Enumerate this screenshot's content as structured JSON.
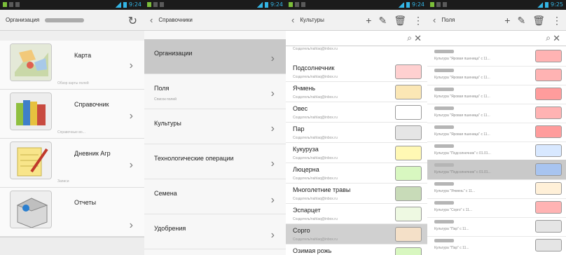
{
  "status_time": "9:24",
  "status_time2": "9:25",
  "panel1": {
    "title": "Организация",
    "items": [
      {
        "label": "Карта",
        "sub": "Обзор карты полей",
        "icon": "map-icon"
      },
      {
        "label": "Справочник",
        "sub": "Справочные во...",
        "icon": "books-icon"
      },
      {
        "label": "Дневник Агр",
        "sub": "Записи",
        "icon": "notepad-icon"
      },
      {
        "label": "Отчеты",
        "sub": "",
        "icon": "box-icon"
      }
    ]
  },
  "panel2": {
    "title": "Справочники",
    "items": [
      {
        "label": "Организации",
        "sub": ""
      },
      {
        "label": "Поля",
        "sub": "Список полей"
      },
      {
        "label": "Культуры",
        "sub": ""
      },
      {
        "label": "Технологические операции",
        "sub": ""
      },
      {
        "label": "Семена",
        "sub": ""
      },
      {
        "label": "Удобрения",
        "sub": ""
      }
    ]
  },
  "panel3": {
    "title": "Культуры",
    "first_mail": "Создатель/nahlaq@inbox.ru",
    "rows": [
      {
        "name": "Подсолнечник",
        "mail": "Создатель/nahlaq@inbox.ru",
        "color": "#ffd0d0"
      },
      {
        "name": "Ячмень",
        "mail": "Создатель/nahlaq@inbox.ru",
        "color": "#fbe7b5"
      },
      {
        "name": "Овес",
        "mail": "Создатель/nahlaq@inbox.ru",
        "color": "#ffffff"
      },
      {
        "name": "Пар",
        "mail": "Создатель/nahlaq@inbox.ru",
        "color": "#e5e5e5"
      },
      {
        "name": "Кукуруза",
        "mail": "Создатель/nahlaq@inbox.ru",
        "color": "#fff8b4"
      },
      {
        "name": "Люцерна",
        "mail": "Создатель/nahlaq@inbox.ru",
        "color": "#d8f7c0"
      },
      {
        "name": "Многолетние травы",
        "mail": "Создатель/nahlaq@inbox.ru",
        "color": "#c8dbb8"
      },
      {
        "name": "Эспарцет",
        "mail": "Создатель/nahlaq@inbox.ru",
        "color": "#eef9e2"
      },
      {
        "name": "Сорго",
        "mail": "Создатель/nahlaq@inbox.ru",
        "color": "#f4e0c8"
      },
      {
        "name": "Озимая рожь",
        "mail": "",
        "color": "#d8f7c0"
      }
    ]
  },
  "panel4": {
    "title": "Поля",
    "rows": [
      {
        "text": "Культура \"Яровая пшеница\" с 11...",
        "color": "#ffb3b3"
      },
      {
        "text": "Культура \"Яровая пшеница\" с 11...",
        "color": "#ffb3b3"
      },
      {
        "text": "Культура \"Яровая пшеница\" с 11...",
        "color": "#ff9c9c"
      },
      {
        "text": "Культура \"Яровая пшеница\" с 11...",
        "color": "#ffb3b3"
      },
      {
        "text": "Культура \"Яровая пшеница\" с 11...",
        "color": "#ff9c9c"
      },
      {
        "text": "Культура \"Подсолнечник\" с 01.01...",
        "color": "#d8e8ff"
      },
      {
        "text": "Культура \"Подсолнечник\" с 01.01...",
        "color": "#a8c4f0"
      },
      {
        "text": "Культура \"Ячмень\" с 11...",
        "color": "#fff0d8"
      },
      {
        "text": "Культура \"Сорго\" с 11...",
        "color": "#ffb3b3"
      },
      {
        "text": "Культура \"Пар\" с 11...",
        "color": "#e5e5e5"
      },
      {
        "text": "Культура \"Пар\" с 11...",
        "color": "#e5e5e5"
      }
    ]
  }
}
